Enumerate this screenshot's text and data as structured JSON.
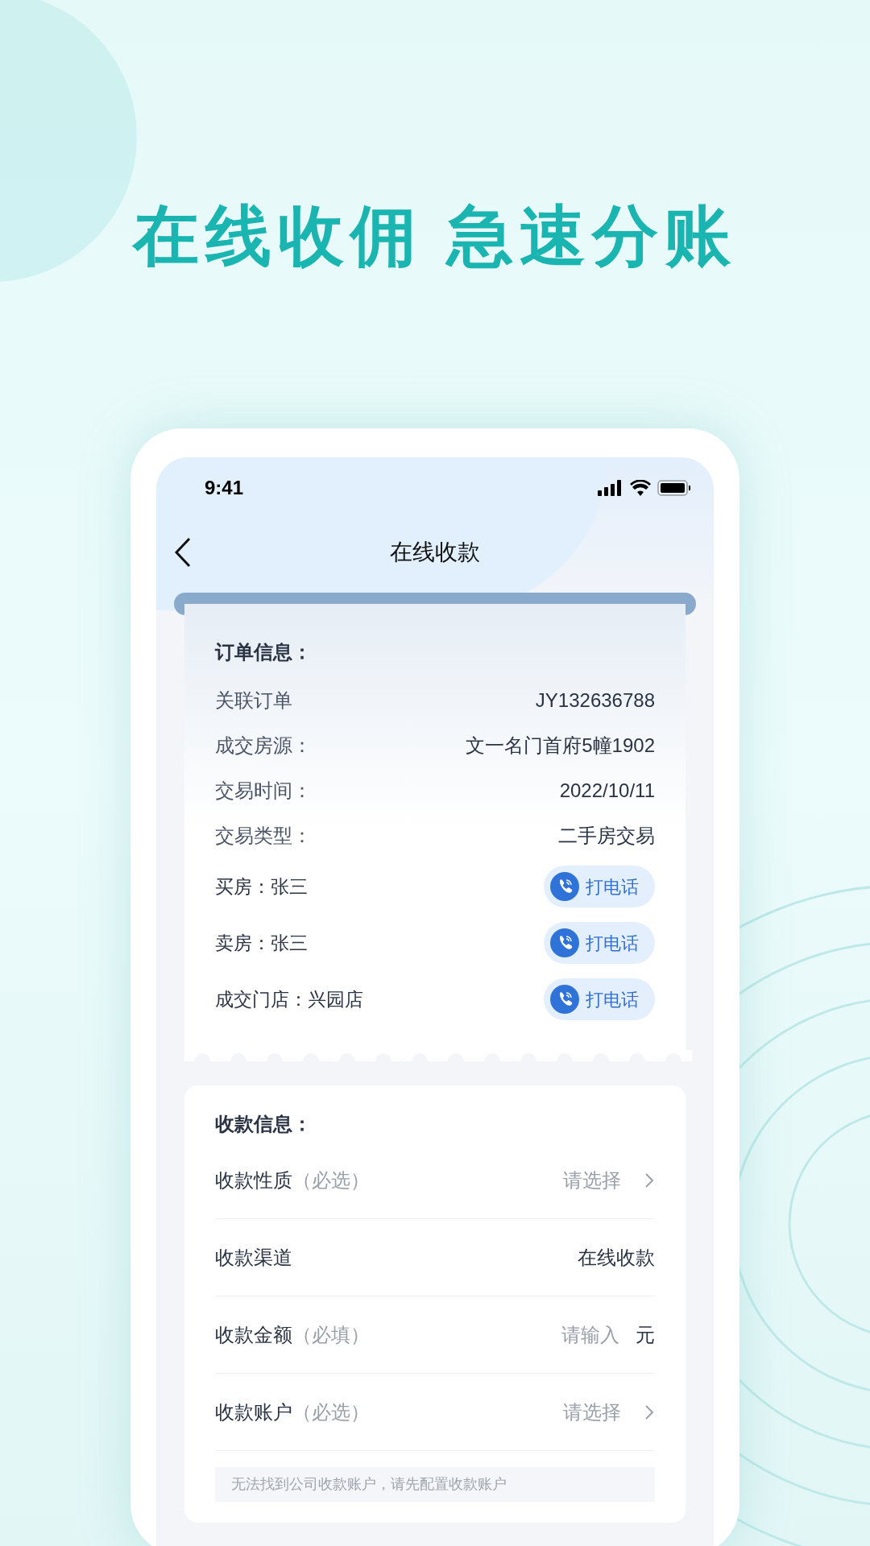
{
  "headline": "在线收佣 急速分账",
  "status_bar": {
    "time": "9:41"
  },
  "nav": {
    "title": "在线收款"
  },
  "order_info": {
    "title": "订单信息：",
    "rows": [
      {
        "kind": "text",
        "label": "关联订单",
        "value": "JY132636788"
      },
      {
        "kind": "text",
        "label": "成交房源：",
        "value": "文一名门首府5幢1902"
      },
      {
        "kind": "text",
        "label": "交易时间：",
        "value": "2022/10/11"
      },
      {
        "kind": "text",
        "label": "交易类型：",
        "value": "二手房交易"
      },
      {
        "kind": "contact",
        "label": "买房：张三",
        "action": "打电话"
      },
      {
        "kind": "contact",
        "label": "卖房：张三",
        "action": "打电话"
      },
      {
        "kind": "contact",
        "label": "成交门店：兴园店",
        "action": "打电话"
      }
    ]
  },
  "payment_info": {
    "title": "收款信息：",
    "fields": [
      {
        "kind": "select",
        "label": "收款性质",
        "hint": "（必选）",
        "placeholder": "请选择"
      },
      {
        "kind": "text",
        "label": "收款渠道",
        "value": "在线收款"
      },
      {
        "kind": "input",
        "label": "收款金额",
        "hint": "（必填）",
        "placeholder": "请输入",
        "unit": "元"
      },
      {
        "kind": "select",
        "label": "收款账户",
        "hint": "（必选）",
        "placeholder": "请选择"
      }
    ],
    "notice": "无法找到公司收款账户，请先配置收款账户"
  }
}
